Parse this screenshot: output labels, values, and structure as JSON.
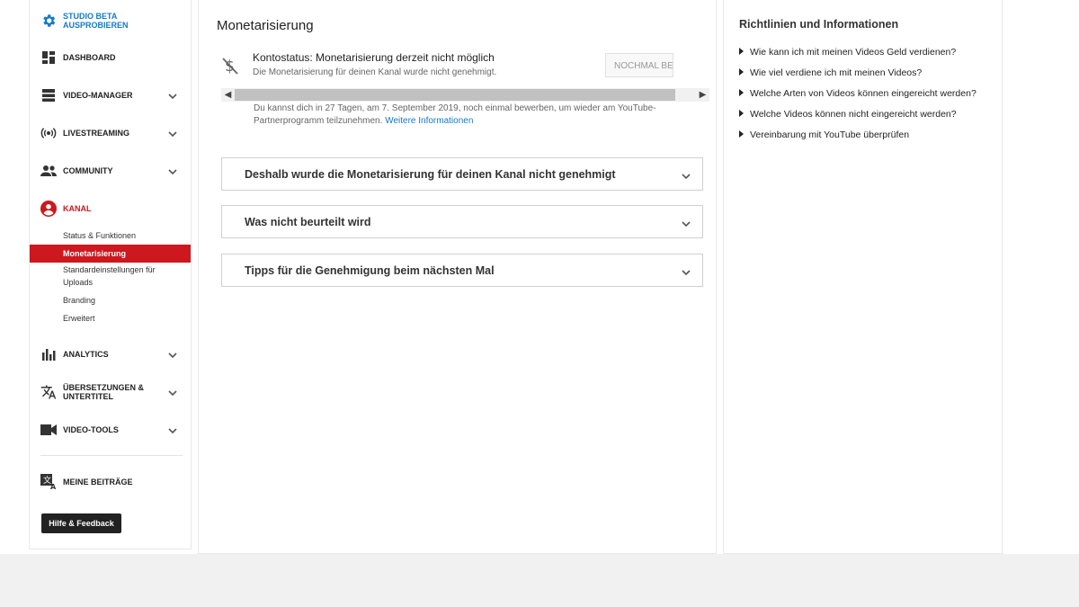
{
  "sidebar": {
    "studio_beta": "STUDIO BETA AUSPROBIEREN",
    "items": [
      {
        "label": "DASHBOARD"
      },
      {
        "label": "VIDEO-MANAGER"
      },
      {
        "label": "LIVESTREAMING"
      },
      {
        "label": "COMMUNITY"
      },
      {
        "label": "KANAL"
      },
      {
        "label": "ANALYTICS"
      },
      {
        "label": "ÜBERSETZUNGEN & UNTERTITEL"
      },
      {
        "label": "VIDEO-TOOLS"
      },
      {
        "label": "MEINE BEITRÄGE"
      }
    ],
    "kanal_sub": [
      {
        "label": "Status & Funktionen"
      },
      {
        "label": "Monetarisierung"
      },
      {
        "label": "Standardeinstellungen für Uploads"
      },
      {
        "label": "Branding"
      },
      {
        "label": "Erweitert"
      }
    ],
    "help_label": "Hilfe & Feedback"
  },
  "main": {
    "title": "Monetarisierung",
    "status_title": "Kontostatus: Monetarisierung derzeit nicht möglich",
    "status_sub": "Die Monetarisierung für deinen Kanal wurde nicht genehmigt.",
    "retry_label": "NOCHMAL BEANTRAGEN",
    "note_text": "Du kannst dich in 27 Tagen, am 7. September 2019, noch einmal bewerben, um wieder am YouTube-Partnerprogramm teilzunehmen.",
    "note_link": "Weitere Informationen",
    "accordions": [
      {
        "label": "Deshalb wurde die Monetarisierung für deinen Kanal nicht genehmigt"
      },
      {
        "label": "Was nicht beurteilt wird"
      },
      {
        "label": "Tipps für die Genehmigung beim nächsten Mal"
      }
    ]
  },
  "right": {
    "title": "Richtlinien und Informationen",
    "links": [
      {
        "label": "Wie kann ich mit meinen Videos Geld verdienen?"
      },
      {
        "label": "Wie viel verdiene ich mit meinen Videos?"
      },
      {
        "label": "Welche Arten von Videos können eingereicht werden?"
      },
      {
        "label": "Welche Videos können nicht eingereicht werden?"
      },
      {
        "label": "Vereinbarung mit YouTube überprüfen"
      }
    ]
  },
  "colors": {
    "accent_blue": "#167ac6",
    "active_red": "#cc181e",
    "page_bg": "#f1f1f1"
  }
}
